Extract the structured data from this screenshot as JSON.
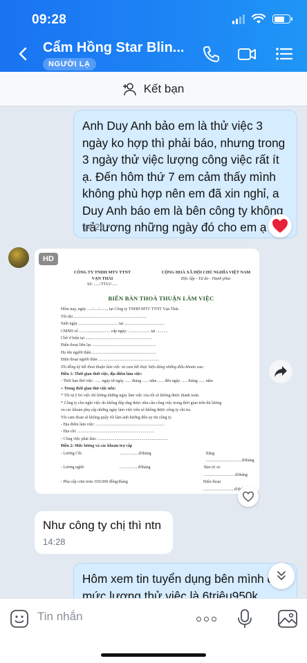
{
  "status_bar": {
    "time": "09:28"
  },
  "header": {
    "contact_name": "Cẩm Hồng Star Blin...",
    "badge": "NGƯỜI LẠ",
    "bg_color": "#1a7cf3"
  },
  "add_friend": {
    "label": "Kết bạn"
  },
  "messages": {
    "out1": {
      "text": "Anh Duy Anh bảo em là thử việc 3 ngày ko hợp thì phải báo, nhưng trong 3 ngày thử việc lượng công việc rất ít ạ. Đến hôm thứ 7 em cảm thấy mình không phù hợp nên em đã xin nghỉ, a Duy Anh báo em là bên công ty không trả lương những ngày đó cho em ạ",
      "time": "14:26",
      "reaction": "heart"
    },
    "image": {
      "hd_label": "HD",
      "doc": {
        "company_line1": "CÔNG TY TNHH MTV TTNT",
        "company_line2": "VẠN THÁI",
        "nation_line1": "CỘNG HOÀ XÃ HỘI CHỦ NGHĨA VIỆT NAM",
        "nation_line2": "Độc lập - Tự do - Hạnh phúc",
        "number": "Số: ....../TTLV-.....",
        "title": "BIÊN BẢN THOẢ THUẬN LÀM VIỆC",
        "intro": "Hôm nay, ngày ...../...../......., tại Công ty TNHH MTV TTNT Vạn Thái.",
        "fields": [
          "Tôi tên ......................................................................",
          "Sinh ngày ...................................... tại .......................................",
          "CMND số .............................. cấp ngày: ..................... tại ...........",
          "Chỗ ở hiện tại ................................................................",
          "Điện thoại liên lạc .............................................................",
          "Họ tên người thân ..............................................................",
          "Điện thoại người thân ..........................................................."
        ],
        "agreement": "Tôi đồng ký kết thoả thuận làm việc và cam kết thực hiện đúng những điều khoản sau:",
        "article1": "Điều 1: Thời gian thời việc, địa điểm làm việc:",
        "trial": "- Thời hạn thử việc: ...... ngày từ ngày ...... tháng ...... năm ...... đến ngày ...... tháng ...... năm",
        "trial_note_head": "+ Trong thời gian thử việc nếu:",
        "trial_note1": "* Tôi tự ý bỏ việc thì lương những ngày làm việc của tôi sẽ không được thanh toán.",
        "trial_note2": "* Công ty cho nghỉ việc do không đáp ứng được nhu cầu công việc trong thời gian trên thì lương",
        "trial_note3": "và các khoản phụ cấp những ngày làm việc trên sẽ không được công ty chi trả.",
        "trial_note4": "Tôi cam đoan sẽ không quấy rối làm ảnh hưởng đến uy tín công ty.",
        "workplace": [
          "- Địa điểm làm việc: ..................................................................",
          "- Địa chỉ: ..........................................................................",
          "- Công việc phải làm: ...................................................................."
        ],
        "article2": "Điều 2: Mức lương và các khoản trợ cấp",
        "salary_rows": [
          [
            "- Lương CB: ",
            "..................đ/tháng",
            "Xăng ...................................đ/tháng"
          ],
          [
            "- Lương nghề: ",
            "..................đ/tháng",
            "Bảo trì xe ..............................đ/tháng"
          ],
          [
            "- Phụ cấp cơm trưa: 650.000 đồng/tháng",
            "",
            "Điện thoại ..............................đ/tháng"
          ]
        ]
      }
    },
    "in1": {
      "text": "Như công ty chị thì ntn",
      "time": "14:28"
    },
    "out2": {
      "text": "Hôm xem tin tuyển dụng bên mình để mức lương thử việc là 6triệu950k,"
    }
  },
  "input_bar": {
    "placeholder": "Tin nhắn"
  },
  "colors": {
    "accent": "#1a7cf3",
    "out_bubble": "#d6ecff",
    "reaction": "#e8203a"
  }
}
